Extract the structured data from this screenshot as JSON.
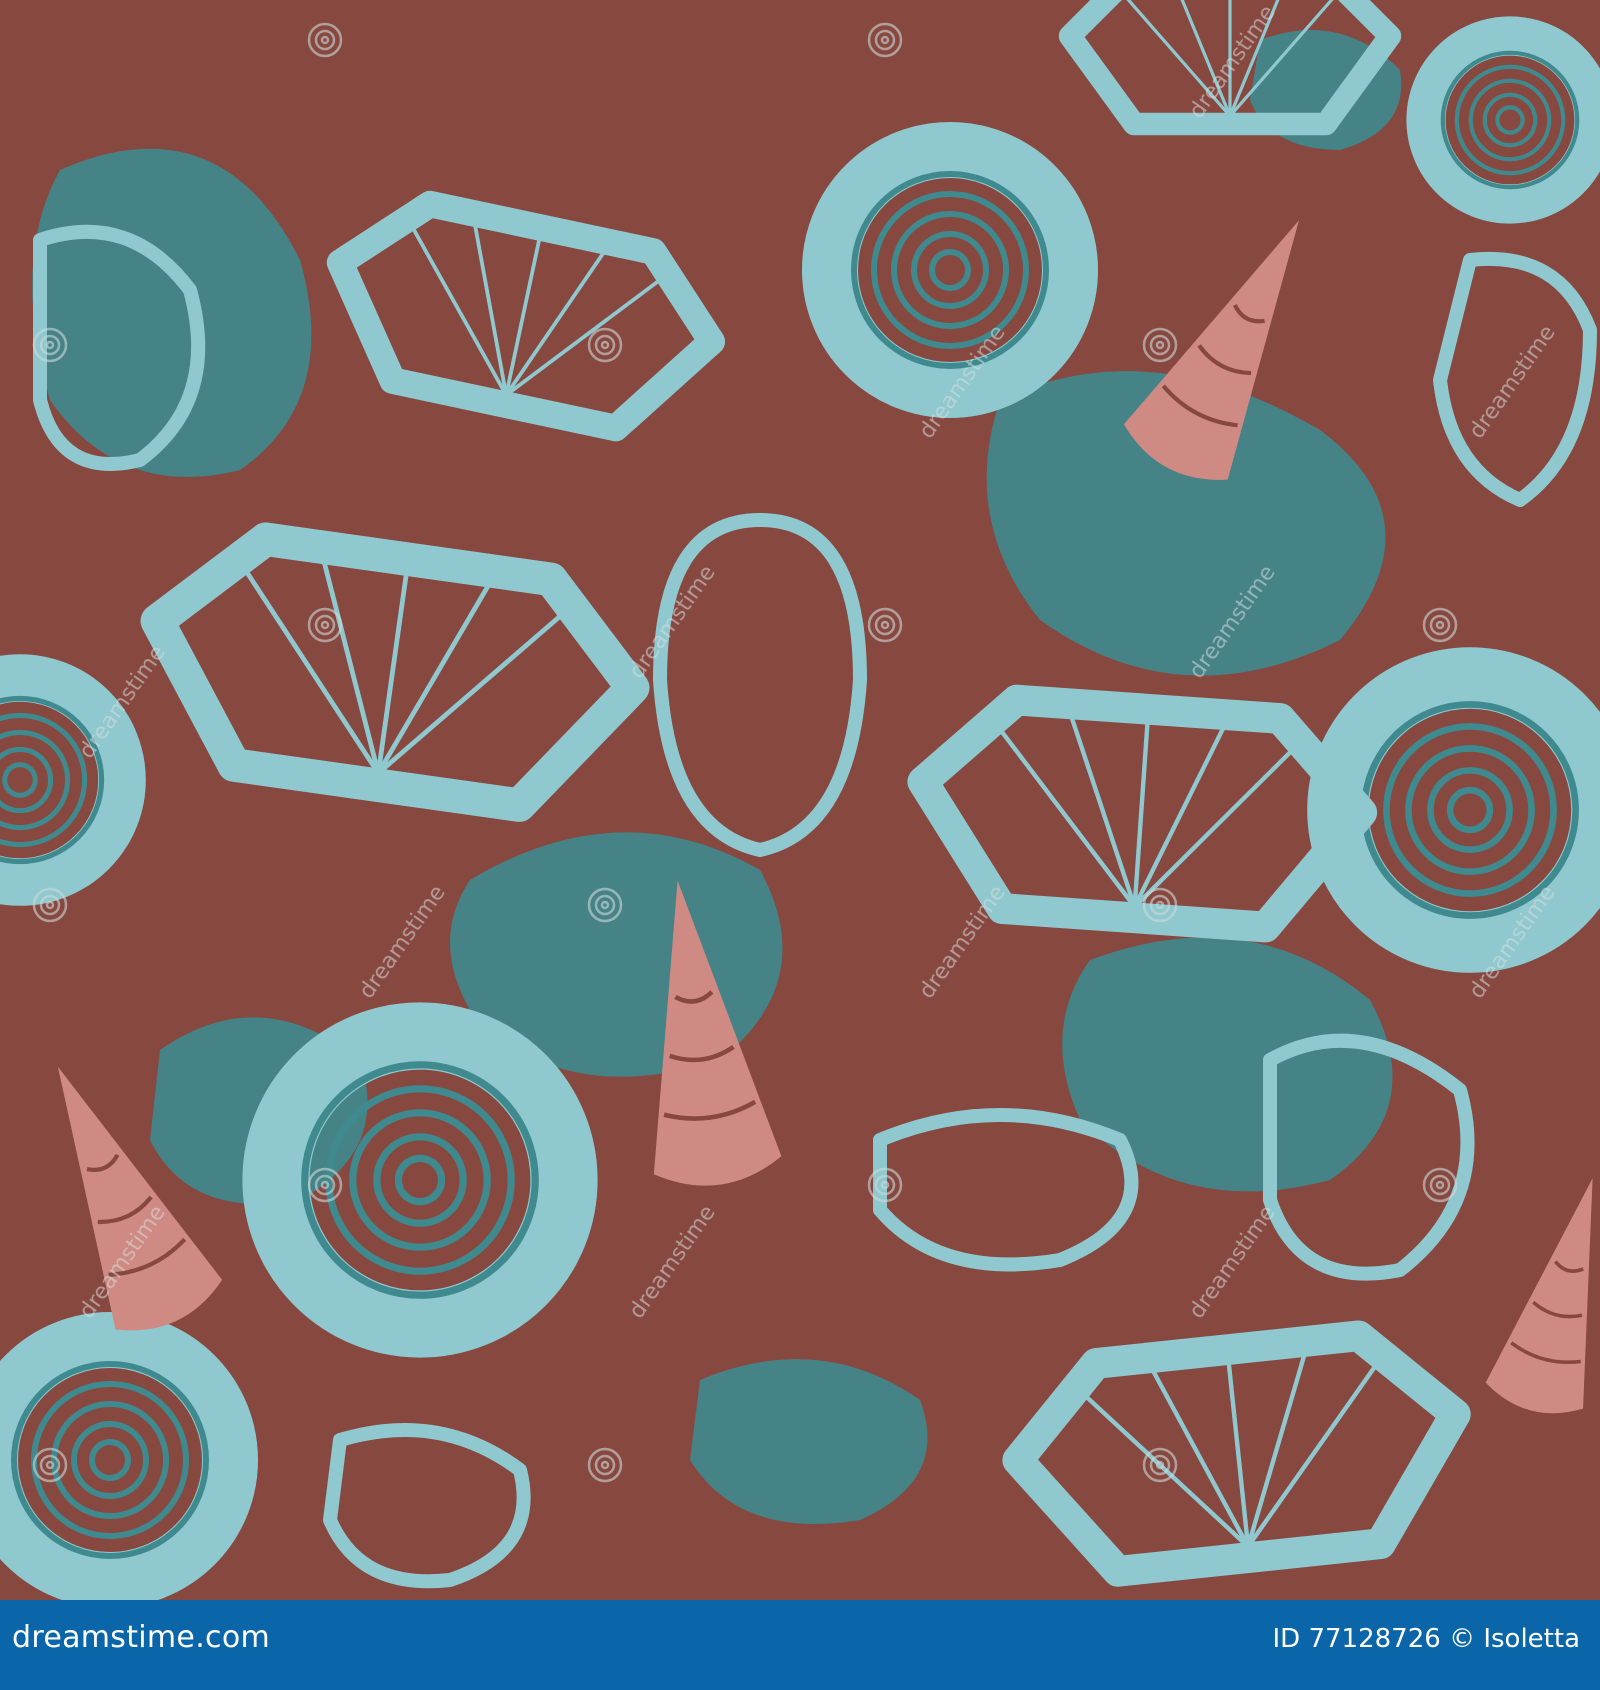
{
  "colors": {
    "background": "#874840",
    "shell_light": "#8fc9cf",
    "shell_dark": "#3f8a8e",
    "shell_pink": "#cf8a83",
    "footer_bar": "#0a66a8",
    "footer_text": "#ffffff"
  },
  "artwork": {
    "watermark_text": "dreamstime"
  },
  "footer": {
    "site": "dreamstime.com",
    "credit": "ID 77128726 © Isoletta"
  }
}
